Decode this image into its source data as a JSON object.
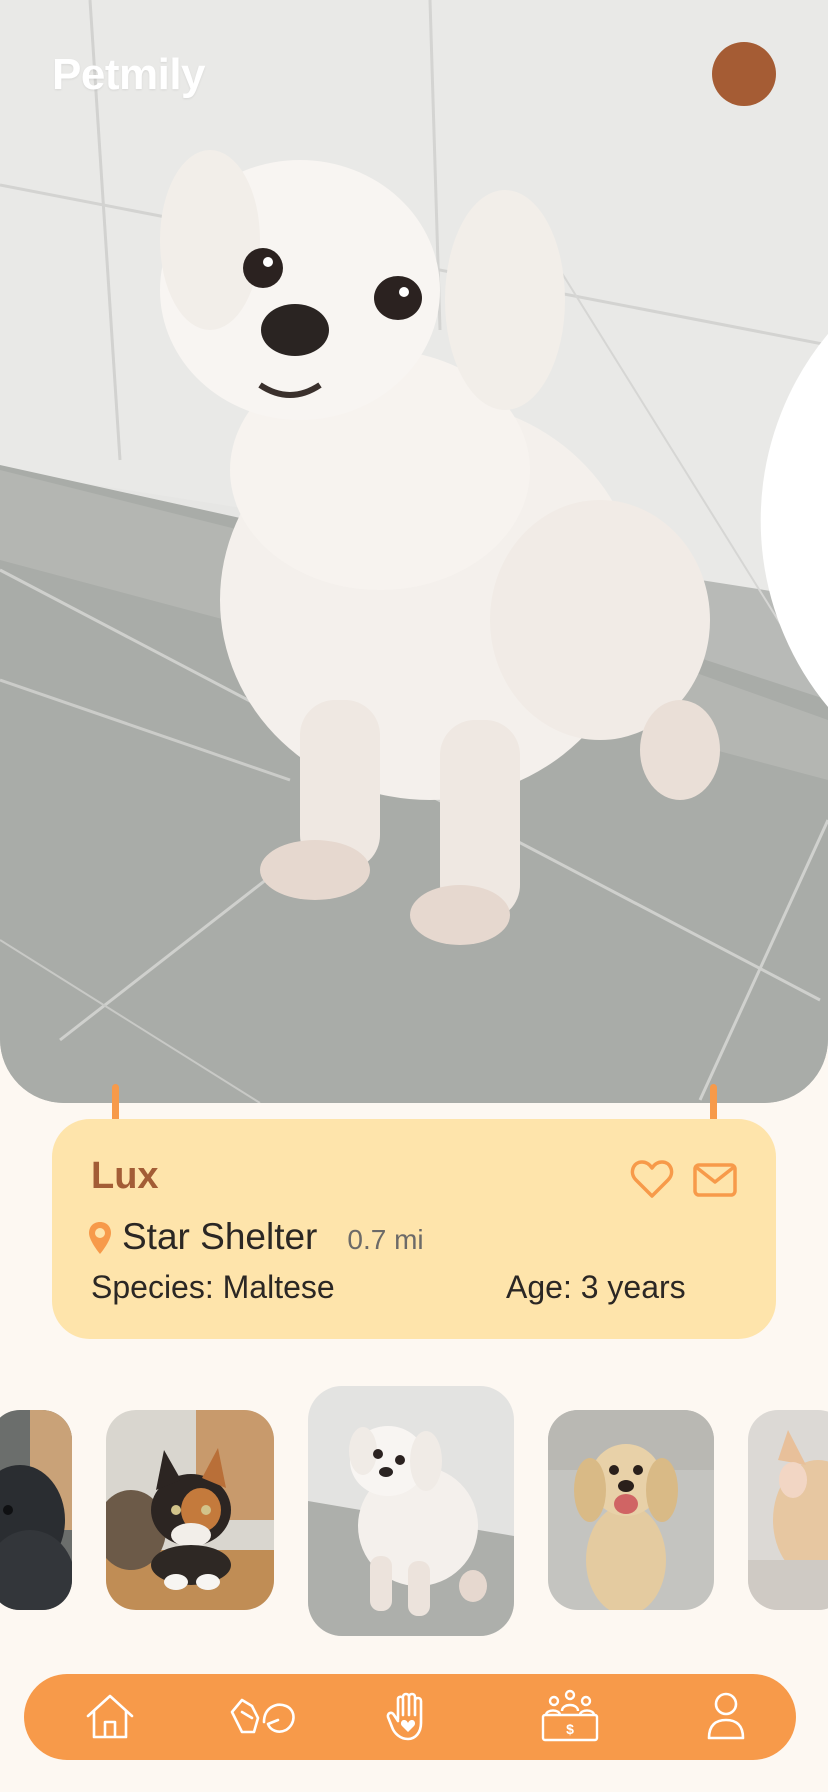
{
  "app": {
    "brand": "Petmily"
  },
  "header": {
    "search_icon": "search-icon"
  },
  "pet": {
    "name": "Lux",
    "shelter": "Star Shelter",
    "distance": "0.7 mi",
    "species": "Species: Maltese",
    "age": "Age: 3 years"
  },
  "thumbnails": [
    {
      "subject": "black dog",
      "selected": false
    },
    {
      "subject": "calico kitten",
      "selected": false
    },
    {
      "subject": "white maltese dog",
      "selected": true
    },
    {
      "subject": "cocker spaniel",
      "selected": false
    },
    {
      "subject": "orange cat",
      "selected": false
    }
  ],
  "nav": {
    "items": [
      "home-icon",
      "pet-hand-icon",
      "raised-hand-heart-icon",
      "donation-icon",
      "profile-icon"
    ]
  },
  "colors": {
    "accent": "#f79a4a",
    "brown": "#a55c34",
    "card": "#fee4ab",
    "background": "#fdf8f2"
  }
}
